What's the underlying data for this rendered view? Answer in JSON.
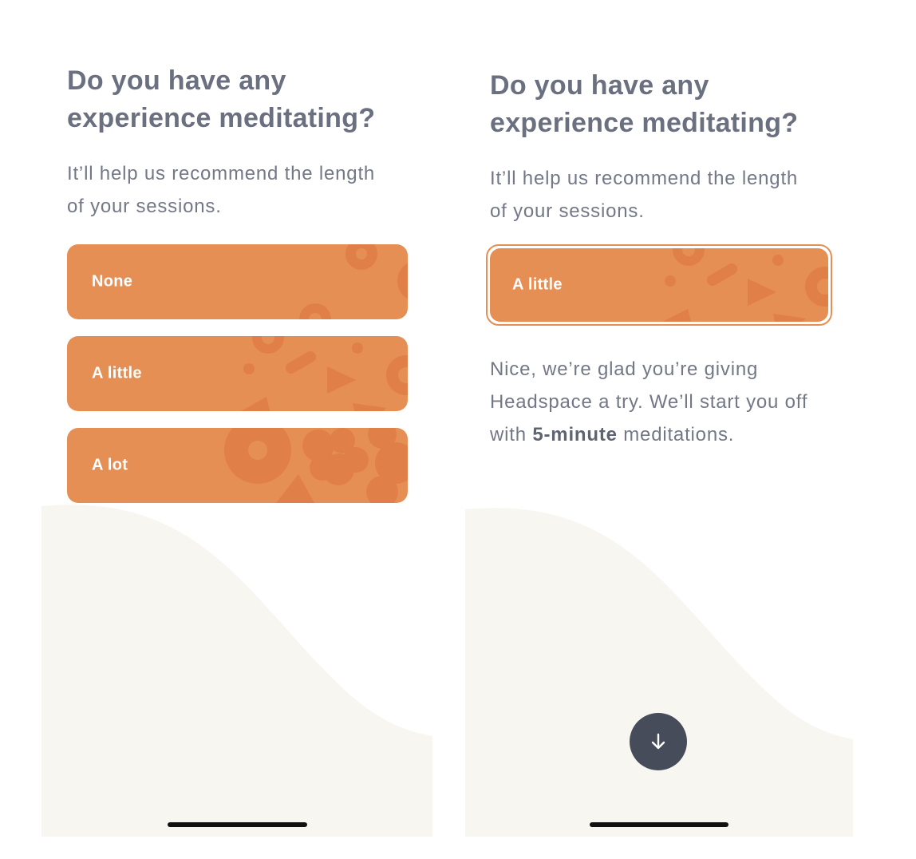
{
  "left": {
    "title_line1": "Do you have any",
    "title_line2": "experience meditating?",
    "subtitle_line1": "It’ll help us recommend the length",
    "subtitle_line2": "of your sessions.",
    "options": [
      {
        "label": "None"
      },
      {
        "label": "A little"
      },
      {
        "label": "A lot"
      }
    ]
  },
  "right": {
    "title_line1": "Do you have any",
    "title_line2": "experience meditating?",
    "subtitle_line1": "It’ll help us recommend the length",
    "subtitle_line2": "of your sessions.",
    "selected_option": {
      "label": "A little"
    },
    "response_line1": "Nice, we’re glad you’re giving",
    "response_line2": "Headspace a try. We’ll start you off",
    "response_line3_prefix": "with ",
    "response_line3_bold": "5-minute",
    "response_line3_suffix": " meditations.",
    "next_button_icon": "arrow-down-icon"
  },
  "colors": {
    "accent": "#e58f55",
    "pattern": "#e17f48",
    "title": "#6b7080",
    "wave": "#f8f6f1",
    "fab": "#474c5a"
  }
}
